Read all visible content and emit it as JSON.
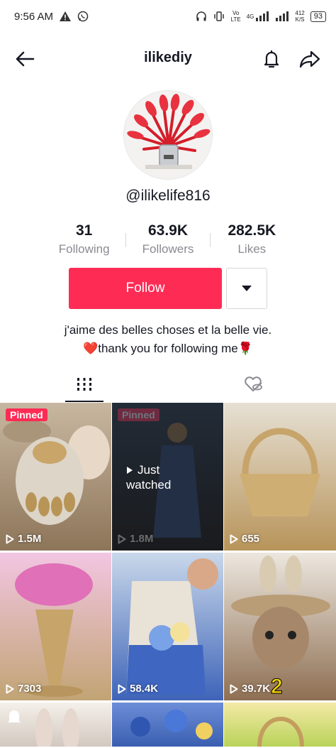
{
  "status_bar": {
    "time": "9:56 AM",
    "network_lines": [
      "Vo",
      "LTE"
    ],
    "network_gen": "4G",
    "speed_lines": [
      "412",
      "K/S"
    ],
    "battery": "93"
  },
  "header": {
    "title": "ilikediy"
  },
  "profile": {
    "username": "@ilikelife816",
    "stats": [
      {
        "value": "31",
        "label": "Following"
      },
      {
        "value": "63.9K",
        "label": "Followers"
      },
      {
        "value": "282.5K",
        "label": "Likes"
      }
    ],
    "follow_label": "Follow",
    "bio": [
      "j'aime des belles choses et la belle vie.",
      "❤️thank you for following me🌹"
    ]
  },
  "videos": [
    {
      "pinned": "Pinned",
      "views": "1.5M",
      "colors": [
        "#c8b7a0",
        "#8d7559"
      ]
    },
    {
      "pinned": "Pinned",
      "views": "1.8M",
      "just_watched": [
        "Just",
        "watched"
      ],
      "colors": [
        "#4a6b95",
        "#2a2d36"
      ]
    },
    {
      "views": "655",
      "colors": [
        "#e6e0d4",
        "#b8945a"
      ]
    },
    {
      "views": "7303",
      "colors": [
        "#f2c6e2",
        "#c1a474"
      ]
    },
    {
      "views": "58.4K",
      "colors": [
        "#c9d8ea",
        "#3e64b8"
      ]
    },
    {
      "views": "39.7K",
      "number": "2",
      "colors": [
        "#ece7df",
        "#8e6f52"
      ]
    },
    {
      "colors": [
        "#f5f0ea",
        "#d2c8c0"
      ]
    },
    {
      "colors": [
        "#6c8dd8",
        "#3b5fb0"
      ]
    },
    {
      "colors": [
        "#f4e9a6",
        "#b9d35a"
      ]
    }
  ]
}
